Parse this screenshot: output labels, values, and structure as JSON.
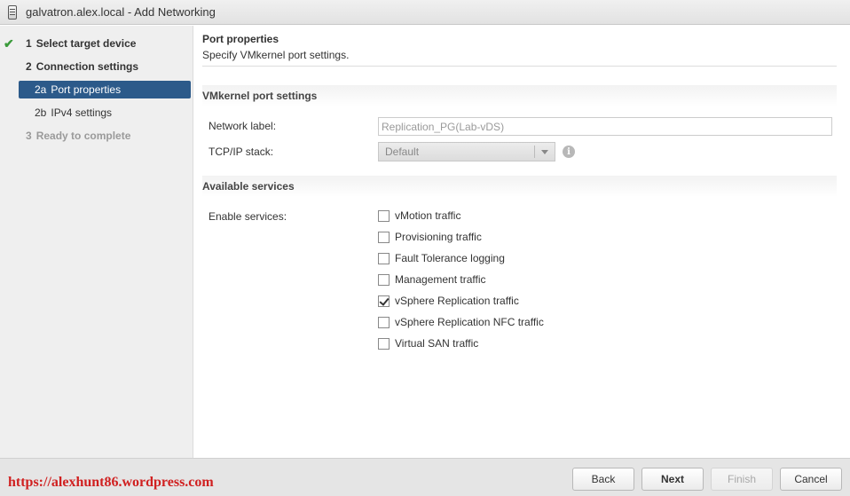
{
  "window": {
    "title": "galvatron.alex.local - Add Networking",
    "icon": "host-icon"
  },
  "wizard_steps": [
    {
      "num": "1",
      "label": "Select target device",
      "state": "completed"
    },
    {
      "num": "2",
      "label": "Connection settings",
      "state": "active-group"
    },
    {
      "num": "2a",
      "label": "Port properties",
      "state": "current"
    },
    {
      "num": "2b",
      "label": "IPv4 settings",
      "state": "pending"
    },
    {
      "num": "3",
      "label": "Ready to complete",
      "state": "disabled"
    }
  ],
  "page": {
    "title": "Port properties",
    "subtitle": "Specify VMkernel port settings."
  },
  "vmkernel_section": {
    "heading": "VMkernel port settings",
    "network_label_label": "Network label:",
    "network_label_value": "Replication_PG(Lab-vDS)",
    "tcpip_label": "TCP/IP stack:",
    "tcpip_value": "Default",
    "info_glyph": "i"
  },
  "services_section": {
    "heading": "Available services",
    "enable_label": "Enable services:",
    "services": [
      {
        "label": "vMotion traffic",
        "checked": false
      },
      {
        "label": "Provisioning traffic",
        "checked": false
      },
      {
        "label": "Fault Tolerance logging",
        "checked": false
      },
      {
        "label": "Management traffic",
        "checked": false
      },
      {
        "label": "vSphere Replication traffic",
        "checked": true
      },
      {
        "label": "vSphere Replication NFC traffic",
        "checked": false
      },
      {
        "label": "Virtual SAN traffic",
        "checked": false
      }
    ]
  },
  "footer": {
    "watermark": "https://alexhunt86.wordpress.com",
    "back": "Back",
    "next": "Next",
    "finish": "Finish",
    "cancel": "Cancel"
  },
  "colors": {
    "current_step_bg": "#2c5a8a",
    "check_green": "#3a9a3a",
    "watermark_red": "#d02020"
  }
}
